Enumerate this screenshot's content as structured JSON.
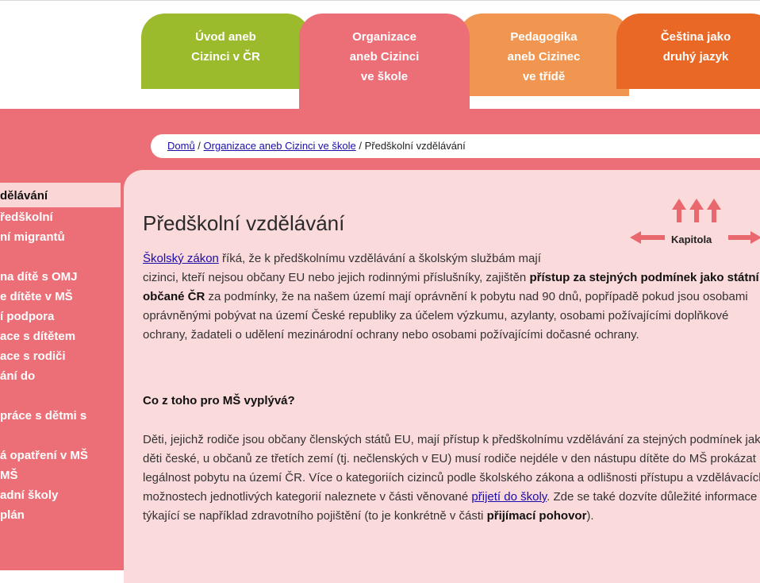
{
  "tabs": [
    {
      "lines": [
        "Úvod aneb",
        "Cizinci v ČR"
      ],
      "color": "#9cbb2c"
    },
    {
      "lines": [
        "Organizace",
        "aneb Cizinci",
        "ve škole"
      ],
      "color": "#ec6f77"
    },
    {
      "lines": [
        "Pedagogika",
        "aneb Cizinec",
        "ve třídě"
      ],
      "color": "#f09650"
    },
    {
      "lines": [
        "Čeština jako",
        "druhý jazyk"
      ],
      "color": "#ea6826"
    }
  ],
  "breadcrumb": {
    "home": "Domů",
    "sep1": " / ",
    "section": "Organizace aneb Cizinci ve škole",
    "sep2": " / ",
    "current": "Předškolní vzdělávání"
  },
  "sidebar": {
    "items": [
      "dělávání",
      "ředškolní",
      "ní migrantů",
      "",
      "na dítě s OMJ",
      "e dítěte v MŠ",
      "í podpora",
      "ace s dítětem",
      "ace s rodiči",
      "ání do",
      "",
      "práce s dětmi s",
      "",
      "á opatření v MŠ",
      "MŠ",
      "adní školy",
      "plán"
    ]
  },
  "content": {
    "title": "Předškolní vzdělávání",
    "kapitola": "Kapitola",
    "p1": {
      "link": "Školský zákon",
      "a": " říká, že k předškolnímu vzdělávání a školským službám mají",
      "b": "cizinci, kteří nejsou občany EU nebo jejich rodinnými příslušníky, zajištěn ",
      "bold": "přístup za stejných podmínek jako státní občané ČR",
      "c": " za podmínky, že na našem území mají oprávnění k pobytu nad 90 dnů, popřípadě pokud jsou osobami oprávněnými pobývat na území České republiky za účelem výzkumu, azylanty, osobami požívajícími doplňkové ochrany, žadateli o udělení mezinárodní ochrany nebo osobami požívajícími dočasné ochrany."
    },
    "subheading": "Co z toho pro MŠ vyplývá?",
    "p2": {
      "a": "Děti, jejichž rodiče jsou občany členských států EU, mají přístup k předškolnímu vzdělávání za stejných podmínek jako děti české, u občanů ze třetích zemí (tj. nečlenských v EU) musí rodiče nejdéle v den nástupu dítěte do MŠ prokázat legálnost pobytu na území ČR. Více o kategoriích cizinců podle školského zákona a odlišnosti přístupu a vzdělávacích možnostech jednotlivých kategorií naleznete v části věnované ",
      "link": "přijetí do školy",
      "b": ". Zde se také dozvíte důležité informace týkající se například zdravotního pojištění (to je konkrétně v části ",
      "bold": "přijímací pohovor",
      "c": ")."
    }
  },
  "colors": {
    "band": "#ec6f77",
    "content_bg": "#fbdadb",
    "arrow": "#e9686e",
    "link": "#1a0dab"
  }
}
